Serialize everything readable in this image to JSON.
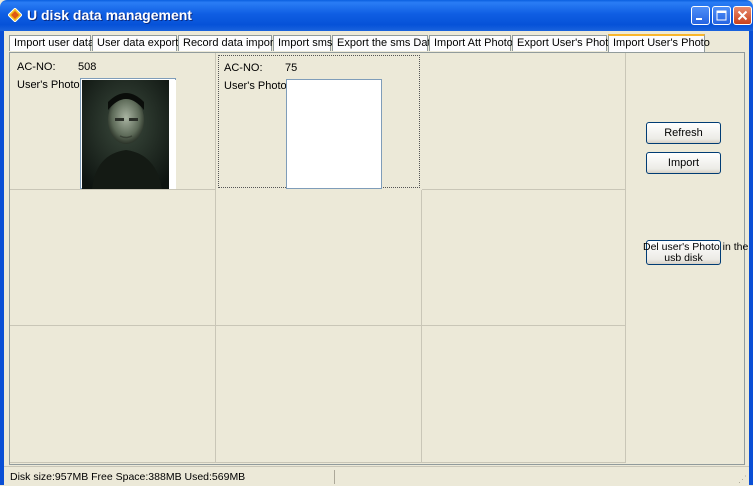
{
  "window": {
    "title": "U disk data management",
    "icon": "diamond-app-icon"
  },
  "tabs": [
    {
      "label": "Import user data",
      "active": false
    },
    {
      "label": "User data export",
      "active": false
    },
    {
      "label": "Record data import",
      "active": false
    },
    {
      "label": "Import sms",
      "active": false
    },
    {
      "label": "Export the sms Data",
      "active": false
    },
    {
      "label": "Import Att Photo",
      "active": false
    },
    {
      "label": "Export User's Photo",
      "active": false
    },
    {
      "label": "Import User's Photo",
      "active": true
    }
  ],
  "photos": [
    {
      "acno_label": "AC-NO:",
      "acno": "508",
      "photo_label": "User's Photo:",
      "has_photo": true
    },
    {
      "acno_label": "AC-NO:",
      "acno": "75",
      "photo_label": "User's Photo:",
      "has_photo": false
    }
  ],
  "actions": {
    "refresh": "Refresh",
    "import": "Import",
    "delete_line1": "Del user's Photo in the",
    "delete_line2": "usb disk"
  },
  "status": {
    "text": "Disk size:957MB  Free Space:388MB  Used:569MB"
  },
  "colors": {
    "titlebar": "#0a5fdf",
    "active_tab_accent": "#f8b62c"
  }
}
